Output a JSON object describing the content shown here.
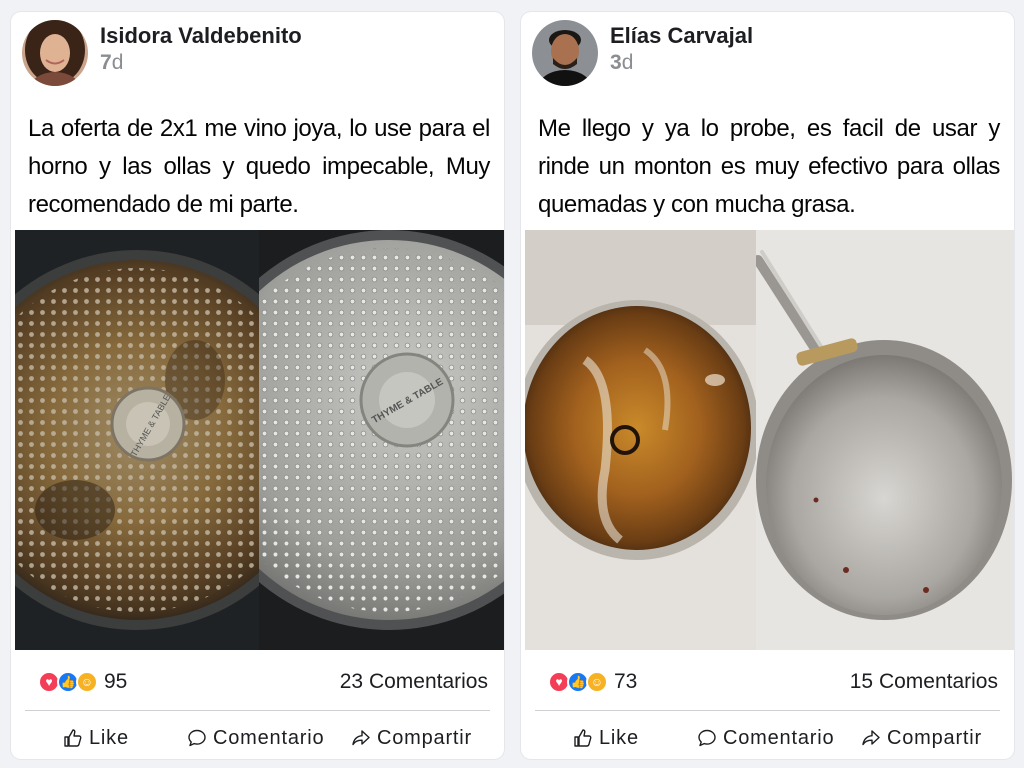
{
  "posts": [
    {
      "author": "Isidora Valdebenito",
      "time_number": "7",
      "time_unit": "d",
      "text": "La oferta de 2x1 me vino joya, lo use para el horno y las ollas y quedo impecable, Muy recomendado de mi parte.",
      "reaction_count": "95",
      "comments": "23 Comentarios",
      "photo": {
        "left_stamp": "THYME & TABLE",
        "right_stamp": "THYME & TABLE"
      }
    },
    {
      "author": "Elías Carvajal",
      "time_number": "3",
      "time_unit": "d",
      "text": "Me llego y ya lo probe, es facil de usar y rinde un monton es muy efectivo para ollas quemadas y con mucha grasa.",
      "reaction_count": "73",
      "comments": "15 Comentarios"
    }
  ],
  "actions": {
    "like": "Like",
    "comment": "Comentario",
    "share": "Compartir"
  },
  "reaction_colors": {
    "love": "#f33e58",
    "like": "#1877f2",
    "care": "#f7b125"
  }
}
